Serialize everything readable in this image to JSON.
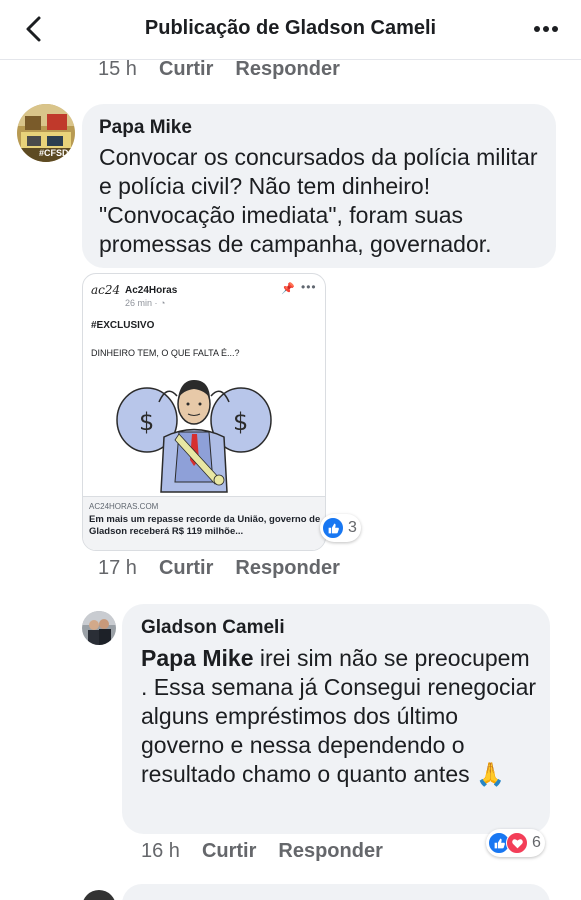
{
  "header": {
    "title": "Publicação de Gladson Cameli"
  },
  "top_actions": {
    "time": "15 h",
    "like": "Curtir",
    "reply": "Responder"
  },
  "comment1": {
    "author": "Papa Mike",
    "text": "Convocar os concursados da polícia militar e polícia civil? Não tem dinheiro! \"Convocação imediata\", foram suas promessas de campanha, governador.",
    "avatar_label": "#CFSD",
    "shared_post": {
      "logo": "ac24",
      "page_name": "Ac24Horas",
      "time": "26 min · ",
      "hashtag": "#EXCLUSIVO",
      "line": "DINHEIRO TEM, O QUE FALTA É...?",
      "domain": "AC24HORAS.COM",
      "headline": "Em mais um repasse recorde da União, governo de Gladson receberá R$ 119 milhõe..."
    },
    "reactions": {
      "count": "3"
    },
    "actions": {
      "time": "17 h",
      "like": "Curtir",
      "reply": "Responder"
    }
  },
  "comment2": {
    "author": "Gladson Cameli",
    "mention": "Papa Mike",
    "text": " irei sim não se preocupem . Essa semana já Consegui renegociar alguns empréstimos dos último governo e nessa dependendo o resultado chamo o quanto antes 🙏",
    "reactions": {
      "count": "6"
    },
    "actions": {
      "time": "16 h",
      "like": "Curtir",
      "reply": "Responder"
    }
  },
  "colors": {
    "bubble": "#f0f2f5",
    "secondary_text": "#65676b",
    "like_blue": "#1877f2",
    "love_red": "#f33e58"
  }
}
